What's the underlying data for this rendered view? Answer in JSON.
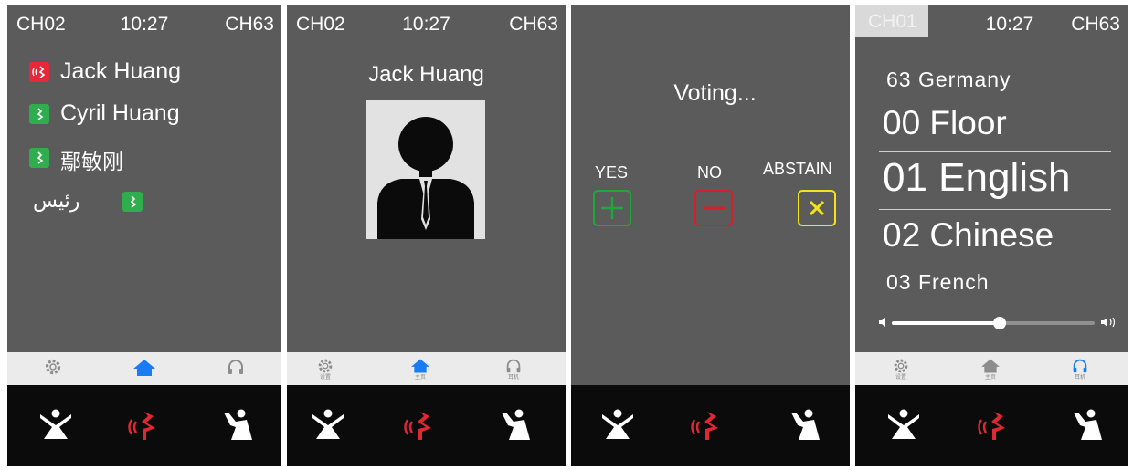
{
  "screens": {
    "speaker_list": {
      "status": {
        "left": "CH02",
        "time": "10:27",
        "right": "CH63"
      },
      "speakers": [
        {
          "name": "Jack Huang",
          "state": "speaking",
          "color": "#e8283a"
        },
        {
          "name": "Cyril Huang",
          "state": "request",
          "color": "#2fae4e"
        },
        {
          "name": "鄢敏刚",
          "state": "request",
          "color": "#2fae4e"
        },
        {
          "name": "رئيس",
          "state": "request",
          "color": "#2fae4e"
        }
      ]
    },
    "speaker_detail": {
      "status": {
        "left": "CH02",
        "time": "10:27",
        "right": "CH63"
      },
      "name": "Jack Huang",
      "tab_labels": {
        "settings": "设置",
        "home": "主页",
        "headphones": "耳机"
      }
    },
    "voting": {
      "title": "Voting...",
      "options": [
        {
          "label": "YES",
          "symbol": "+",
          "color": "#1ea83a"
        },
        {
          "label": "NO",
          "symbol": "−",
          "color": "#d61f2c"
        },
        {
          "label": "ABSTAIN",
          "symbol": "×",
          "color": "#f3e31b"
        }
      ]
    },
    "language": {
      "status": {
        "left": "CH01",
        "time": "10:27",
        "right": "CH63"
      },
      "current_label": "63 Germany",
      "channels": [
        {
          "label": "00 Floor"
        },
        {
          "label": "01 English",
          "selected": true
        },
        {
          "label": "02 Chinese"
        },
        {
          "label": "03 French"
        }
      ],
      "volume_fraction": 0.53,
      "tab_labels": {
        "settings": "设置",
        "home": "主页",
        "headphones": "耳机"
      }
    }
  },
  "bottom_bar": [
    "request-cancel-icon",
    "speak-request-icon",
    "priority-chair-icon"
  ],
  "colors": {
    "active_tab": "#1a7cf5",
    "inactive_tab": "#8d8d8d",
    "speak": "#e02833",
    "panel": "#5b5b5b"
  }
}
